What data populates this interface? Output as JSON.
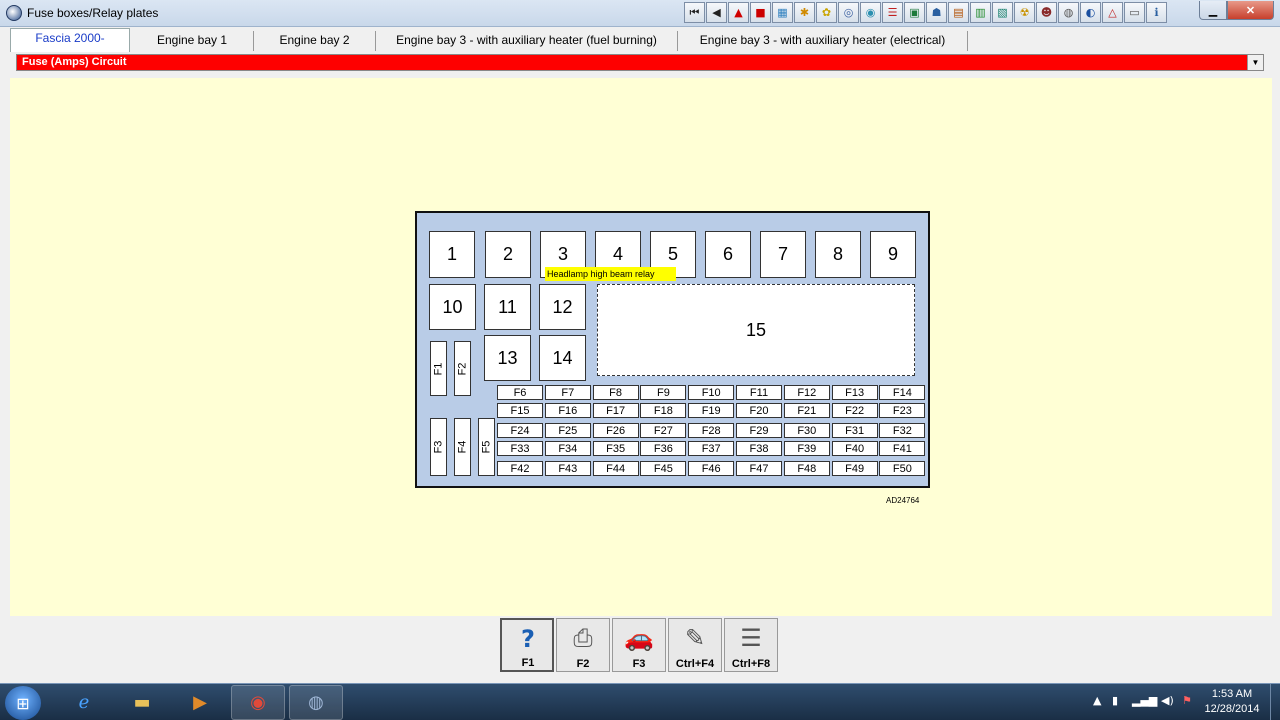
{
  "window": {
    "title": "Fuse boxes/Relay plates"
  },
  "toolbar_icons": [
    "first-page-icon",
    "previous-icon",
    "warning-icon",
    "flag-icon",
    "map-icon",
    "tool-icon",
    "settings-icon",
    "wheel-icon",
    "gauge-icon",
    "checklist-icon",
    "door-icon",
    "person-icon",
    "book-icon",
    "document-icon",
    "tab-icon",
    "engine-icon",
    "face-icon",
    "car-icon",
    "target-icon",
    "caution-icon",
    "vehicle-icon",
    "info-icon"
  ],
  "tabs": [
    {
      "label": "Fascia 2000-",
      "active": true
    },
    {
      "label": "Engine bay 1"
    },
    {
      "label": "Engine bay 2"
    },
    {
      "label": "Engine bay 3 - with auxiliary heater (fuel burning)"
    },
    {
      "label": "Engine bay 3 - with auxiliary heater (electrical)"
    }
  ],
  "dropdown": {
    "value": "Fuse (Amps)  Circuit",
    "color": "#fe0000"
  },
  "diagram": {
    "top_relays": [
      "1",
      "2",
      "3",
      "4",
      "5",
      "6",
      "7",
      "8",
      "9"
    ],
    "mid_relays": [
      "10",
      "11",
      "12"
    ],
    "lower_relays": [
      "13",
      "14"
    ],
    "large_relay": "15",
    "vertical_fuses_upper": [
      "F1",
      "F2"
    ],
    "vertical_fuses_lower": [
      "F3",
      "F4",
      "F5"
    ],
    "fuse_rows": [
      [
        "F6",
        "F7",
        "F8",
        "F9",
        "F10",
        "F11",
        "F12",
        "F13",
        "F14"
      ],
      [
        "F15",
        "F16",
        "F17",
        "F18",
        "F19",
        "F20",
        "F21",
        "F22",
        "F23"
      ],
      [
        "F24",
        "F25",
        "F26",
        "F27",
        "F28",
        "F29",
        "F30",
        "F31",
        "F32"
      ],
      [
        "F33",
        "F34",
        "F35",
        "F36",
        "F37",
        "F38",
        "F39",
        "F40",
        "F41"
      ],
      [
        "F42",
        "F43",
        "F44",
        "F45",
        "F46",
        "F47",
        "F48",
        "F49",
        "F50"
      ]
    ],
    "tooltip": "Headlamp high beam relay",
    "reference": "AD24764",
    "box_color": "#b9cce7"
  },
  "function_buttons": [
    {
      "label": "F1",
      "icon": "help-icon",
      "active": true
    },
    {
      "label": "F2",
      "icon": "printer-icon"
    },
    {
      "label": "F3",
      "icon": "vehicle-icon"
    },
    {
      "label": "Ctrl+F4",
      "icon": "notepad-icon"
    },
    {
      "label": "Ctrl+F8",
      "icon": "list-icon"
    }
  ],
  "taskbar": {
    "clock_time": "1:53 AM",
    "clock_date": "12/28/2014"
  }
}
